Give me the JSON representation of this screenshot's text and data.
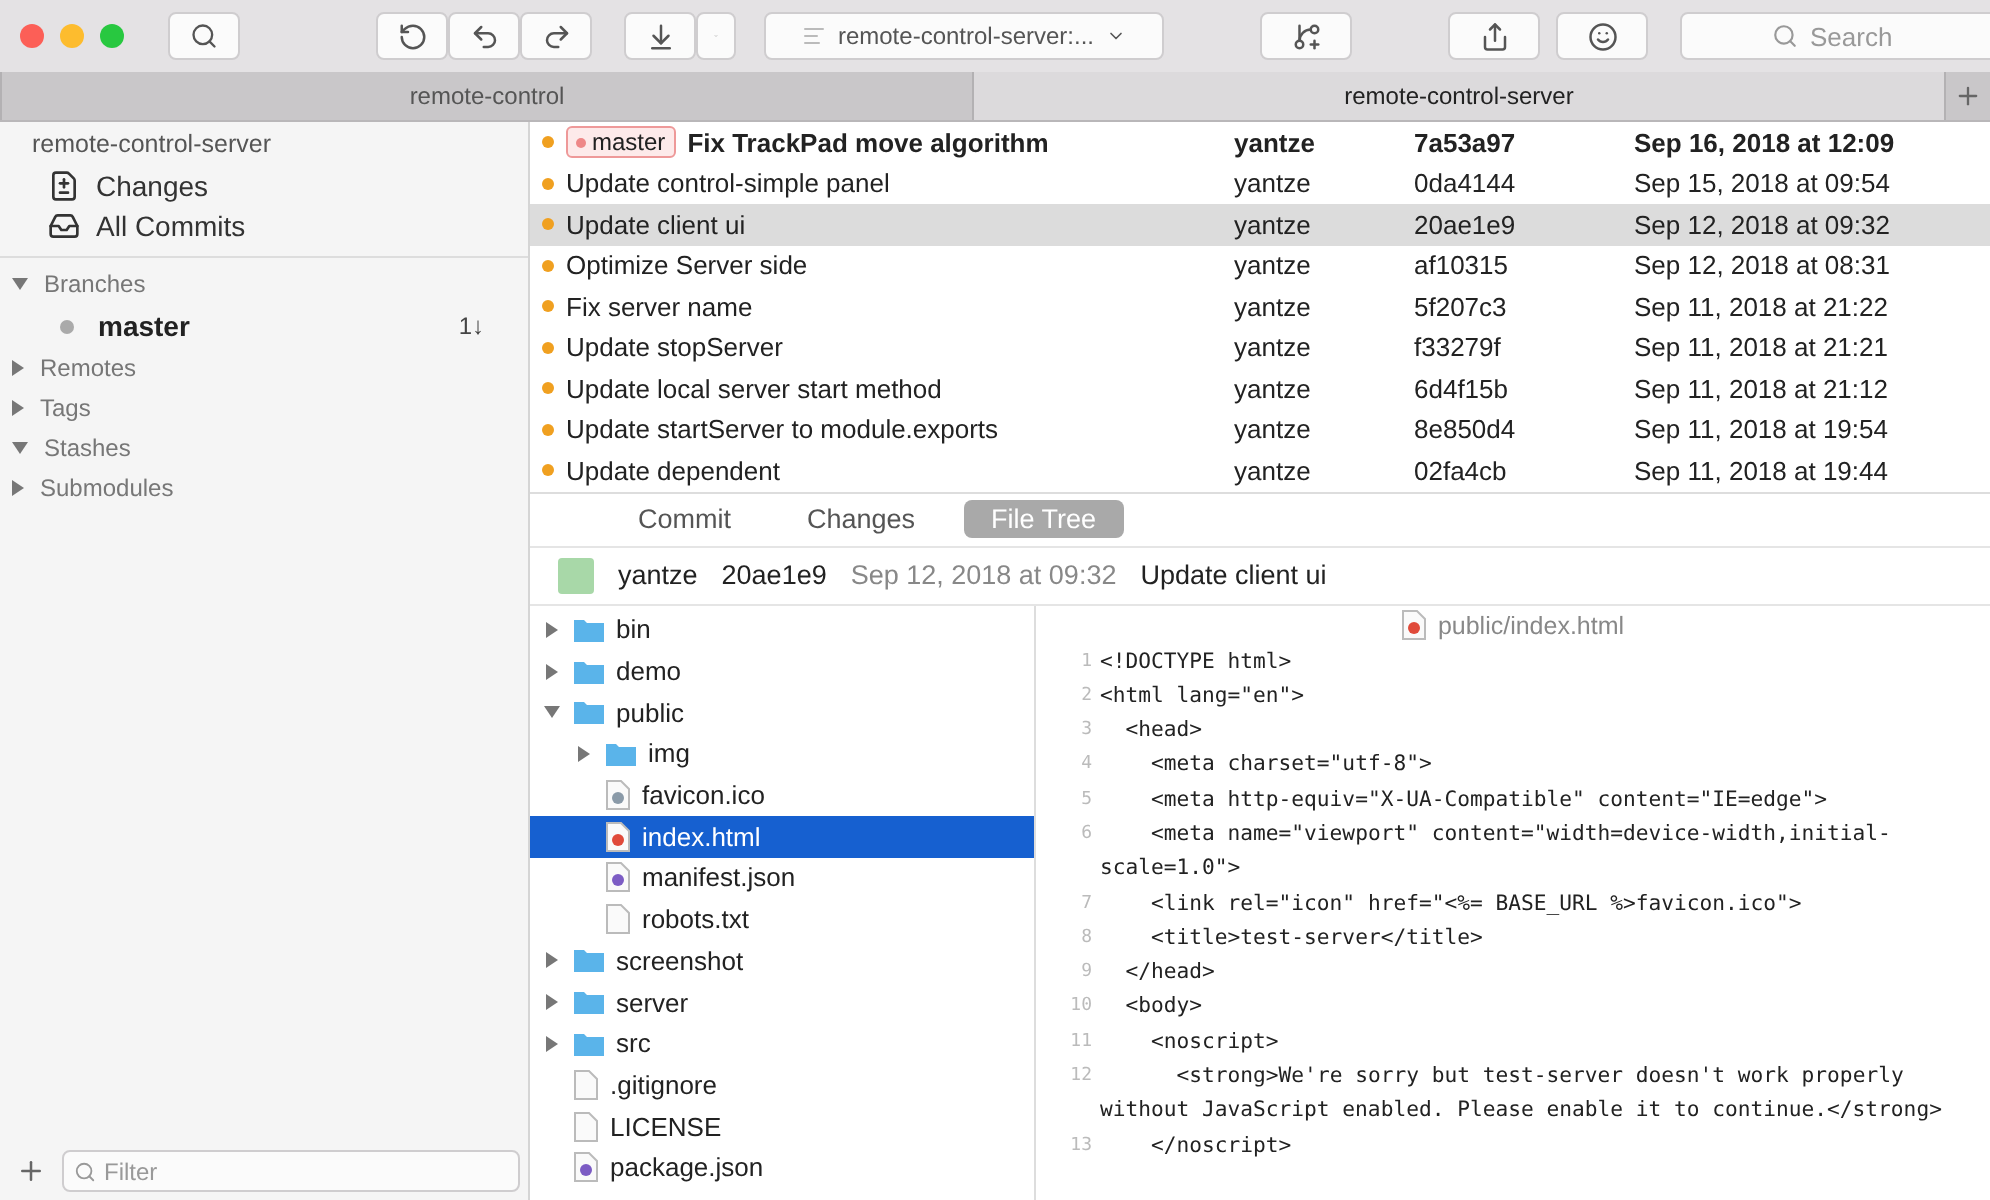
{
  "toolbar": {
    "branch_selector": "remote-control-server:...",
    "search": {
      "placeholder": "Search"
    }
  },
  "tabs": [
    {
      "label": "remote-control",
      "selected": false
    },
    {
      "label": "remote-control-server",
      "selected": true
    }
  ],
  "sidebar": {
    "repository": "remote-control-server",
    "views": [
      {
        "label": "Changes",
        "kind": "changes"
      },
      {
        "label": "All Commits",
        "kind": "commits"
      }
    ],
    "sections": [
      {
        "label": "Branches",
        "expanded": true,
        "children": [
          {
            "label": "master",
            "badge": "1↓",
            "current": true
          }
        ]
      },
      {
        "label": "Remotes",
        "expanded": false
      },
      {
        "label": "Tags",
        "expanded": false
      },
      {
        "label": "Stashes",
        "expanded": true
      },
      {
        "label": "Submodules",
        "expanded": false
      }
    ],
    "filter": {
      "placeholder": "Filter"
    }
  },
  "commits": [
    {
      "branch_tag": "master",
      "message": "Fix TrackPad move algorithm",
      "author": "yantze",
      "hash": "7a53a97",
      "date": "Sep 16, 2018 at 12:09",
      "head": true,
      "selected": false
    },
    {
      "message": "Update control-simple panel",
      "author": "yantze",
      "hash": "0da4144",
      "date": "Sep 15, 2018 at 09:54",
      "head": false,
      "selected": false
    },
    {
      "message": "Update client ui",
      "author": "yantze",
      "hash": "20ae1e9",
      "date": "Sep 12, 2018 at 09:32",
      "head": false,
      "selected": true
    },
    {
      "message": "Optimize Server side",
      "author": "yantze",
      "hash": "af10315",
      "date": "Sep 12, 2018 at 08:31",
      "head": false,
      "selected": false
    },
    {
      "message": "Fix server name",
      "author": "yantze",
      "hash": "5f207c3",
      "date": "Sep 11, 2018 at 21:22",
      "head": false,
      "selected": false
    },
    {
      "message": "Update stopServer",
      "author": "yantze",
      "hash": "f33279f",
      "date": "Sep 11, 2018 at 21:21",
      "head": false,
      "selected": false
    },
    {
      "message": "Update local server start method",
      "author": "yantze",
      "hash": "6d4f15b",
      "date": "Sep 11, 2018 at 21:12",
      "head": false,
      "selected": false
    },
    {
      "message": "Update startServer to module.exports",
      "author": "yantze",
      "hash": "8e850d4",
      "date": "Sep 11, 2018 at 19:54",
      "head": false,
      "selected": false
    },
    {
      "message": "Update dependent",
      "author": "yantze",
      "hash": "02fa4cb",
      "date": "Sep 11, 2018 at 19:44",
      "head": false,
      "selected": false
    }
  ],
  "detail_tabs": [
    {
      "label": "Commit",
      "selected": false
    },
    {
      "label": "Changes",
      "selected": false
    },
    {
      "label": "File Tree",
      "selected": true
    }
  ],
  "commit_header": {
    "author": "yantze",
    "hash": "20ae1e9",
    "date": "Sep 12, 2018 at 09:32",
    "message": "Update client ui"
  },
  "file_tree": [
    {
      "name": "bin",
      "kind": "folder",
      "expanded": false,
      "selected": false
    },
    {
      "name": "demo",
      "kind": "folder",
      "expanded": false,
      "selected": false
    },
    {
      "name": "public",
      "kind": "folder",
      "expanded": true,
      "selected": false,
      "children": [
        {
          "name": "img",
          "kind": "folder",
          "expanded": false,
          "selected": false
        },
        {
          "name": "favicon.ico",
          "kind": "image",
          "selected": false
        },
        {
          "name": "index.html",
          "kind": "html",
          "selected": true
        },
        {
          "name": "manifest.json",
          "kind": "json",
          "selected": false
        },
        {
          "name": "robots.txt",
          "kind": "file",
          "selected": false
        }
      ]
    },
    {
      "name": "screenshot",
      "kind": "folder",
      "expanded": false,
      "selected": false
    },
    {
      "name": "server",
      "kind": "folder",
      "expanded": false,
      "selected": false
    },
    {
      "name": "src",
      "kind": "folder",
      "expanded": false,
      "selected": false
    },
    {
      "name": ".gitignore",
      "kind": "file",
      "selected": false
    },
    {
      "name": "LICENSE",
      "kind": "file",
      "selected": false
    },
    {
      "name": "package.json",
      "kind": "json",
      "selected": false
    }
  ],
  "code_view": {
    "path": "public/index.html",
    "lines": [
      {
        "number": "1",
        "text": "<!DOCTYPE html>"
      },
      {
        "number": "2",
        "text": "<html lang=\"en\">"
      },
      {
        "number": "3",
        "text": "  <head>"
      },
      {
        "number": "4",
        "text": "    <meta charset=\"utf-8\">"
      },
      {
        "number": "5",
        "text": "    <meta http-equiv=\"X-UA-Compatible\" content=\"IE=edge\">"
      },
      {
        "number": "6",
        "text": "    <meta name=\"viewport\" content=\"width=device-width,initial-scale=1.0\">"
      },
      {
        "number": "7",
        "text": "    <link rel=\"icon\" href=\"<%= BASE_URL %>favicon.ico\">"
      },
      {
        "number": "8",
        "text": "    <title>test-server</title>"
      },
      {
        "number": "9",
        "text": "  </head>"
      },
      {
        "number": "10",
        "text": "  <body>"
      },
      {
        "number": "11",
        "text": "    <noscript>"
      },
      {
        "number": "12",
        "text": "      <strong>We're sorry but test-server doesn't work properly without JavaScript enabled. Please enable it to continue.</strong>"
      },
      {
        "number": "13",
        "text": "    </noscript>"
      }
    ]
  }
}
